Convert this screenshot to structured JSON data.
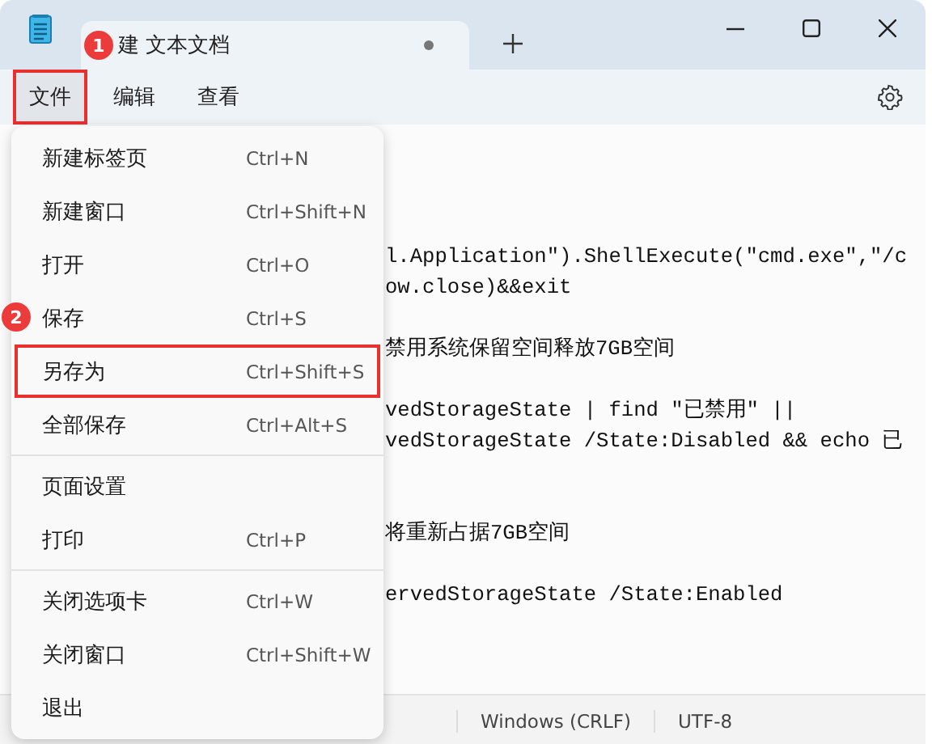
{
  "window": {
    "tab_title": "建 文本文档",
    "tab_modified": true,
    "tab_badge": "1"
  },
  "menu_bar": [
    {
      "label": "文件",
      "selected": true,
      "annotated": true
    },
    {
      "label": "编辑",
      "selected": false,
      "annotated": false
    },
    {
      "label": "查看",
      "selected": false,
      "annotated": false
    }
  ],
  "file_menu": {
    "groups": [
      [
        {
          "label": "新建标签页",
          "shortcut": "Ctrl+N",
          "annotated": false
        },
        {
          "label": "新建窗口",
          "shortcut": "Ctrl+Shift+N",
          "annotated": false
        },
        {
          "label": "打开",
          "shortcut": "Ctrl+O",
          "annotated": false
        },
        {
          "label": "保存",
          "shortcut": "Ctrl+S",
          "annotated": false,
          "badge": "2"
        },
        {
          "label": "另存为",
          "shortcut": "Ctrl+Shift+S",
          "annotated": true
        },
        {
          "label": "全部保存",
          "shortcut": "Ctrl+Alt+S",
          "annotated": false
        }
      ],
      [
        {
          "label": "页面设置",
          "annotated": false
        },
        {
          "label": "打印",
          "shortcut": "Ctrl+P",
          "annotated": false
        }
      ],
      [
        {
          "label": "关闭选项卡",
          "shortcut": "Ctrl+W",
          "annotated": false
        },
        {
          "label": "关闭窗口",
          "shortcut": "Ctrl+Shift+W",
          "annotated": false
        },
        {
          "label": "退出",
          "annotated": false
        }
      ]
    ]
  },
  "editor": {
    "lines": [
      {
        "kind": "text",
        "text": "l.Application\").ShellExecute(\"cmd.exe\",\"/c"
      },
      {
        "kind": "text",
        "text": "ow.close)&&exit"
      },
      {
        "kind": "blank"
      },
      {
        "kind": "text",
        "text": "禁用系统保留空间释放7GB空间"
      },
      {
        "kind": "blank"
      },
      {
        "kind": "text",
        "text": "vedStorageState | find \"已禁用\" ||"
      },
      {
        "kind": "text",
        "text": "vedStorageState /State:Disabled && echo 已"
      },
      {
        "kind": "blank"
      },
      {
        "kind": "blank"
      },
      {
        "kind": "text",
        "text": "将重新占据7GB空间"
      },
      {
        "kind": "blank"
      },
      {
        "kind": "text",
        "text": "ervedStorageState /State:Enabled"
      }
    ]
  },
  "status_bar": [
    "Windows (CRLF)",
    "UTF-8"
  ]
}
